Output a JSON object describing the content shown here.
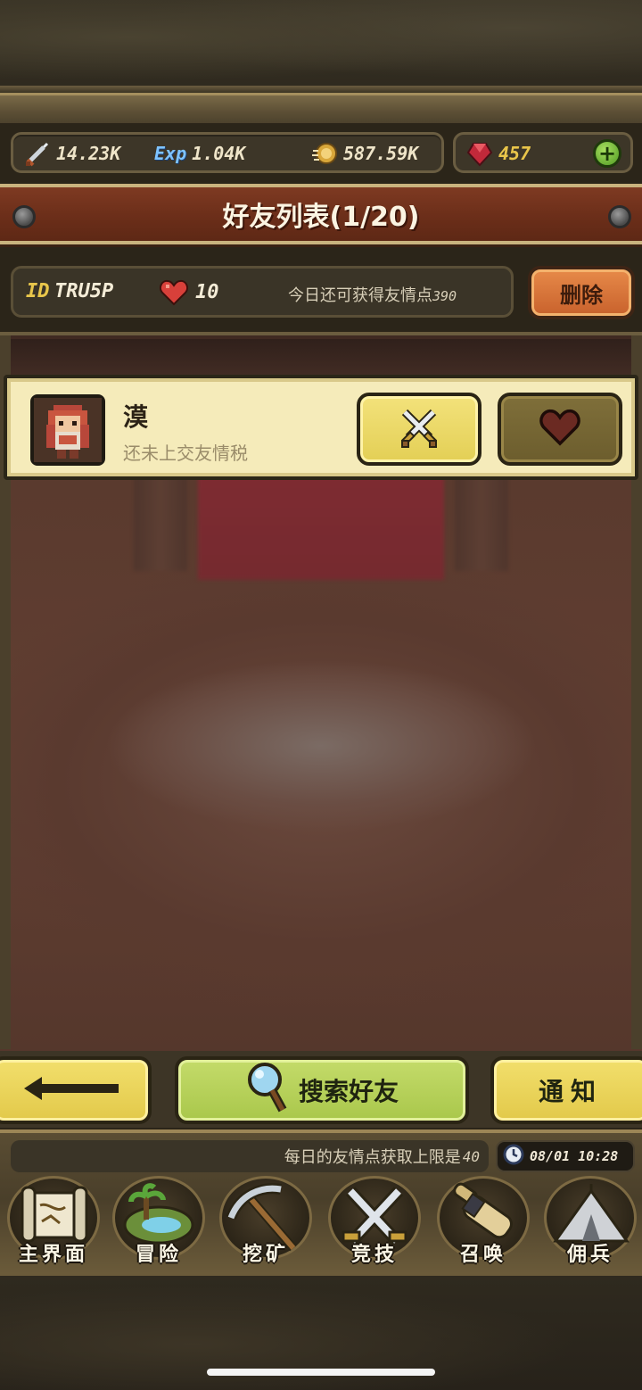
{
  "resources": {
    "attack": "14.23K",
    "exp_label": "Exp",
    "exp": "1.04K",
    "gold": "587.59K",
    "gems": "457"
  },
  "title": "好友列表(1/20)",
  "info_bar": {
    "id_label": "ID",
    "id_value": "TRU5P",
    "hearts": "10",
    "friendship_remaining_label": "今日还可获得友情点",
    "friendship_remaining_value": "390"
  },
  "delete_button": "删除",
  "friends": [
    {
      "name": "漠",
      "status": "还未上交友情税"
    }
  ],
  "actions": {
    "search_friend": "搜索好友",
    "notice": "通知"
  },
  "daily_limit": {
    "label": "每日的友情点获取上限是",
    "value": "40"
  },
  "clock": "08/01 10:28",
  "nav": {
    "home": "主界面",
    "adventure": "冒险",
    "mining": "挖矿",
    "arena": "竞技",
    "summon": "召唤",
    "mercenary": "佣兵"
  },
  "colors": {
    "banner_red": "#6d2f1a",
    "card_cream": "#f5ebba",
    "button_yellow": "#e3cf55",
    "button_green": "#a9c74b",
    "delete_orange": "#c8612c",
    "gem_text": "#e9c54a"
  }
}
